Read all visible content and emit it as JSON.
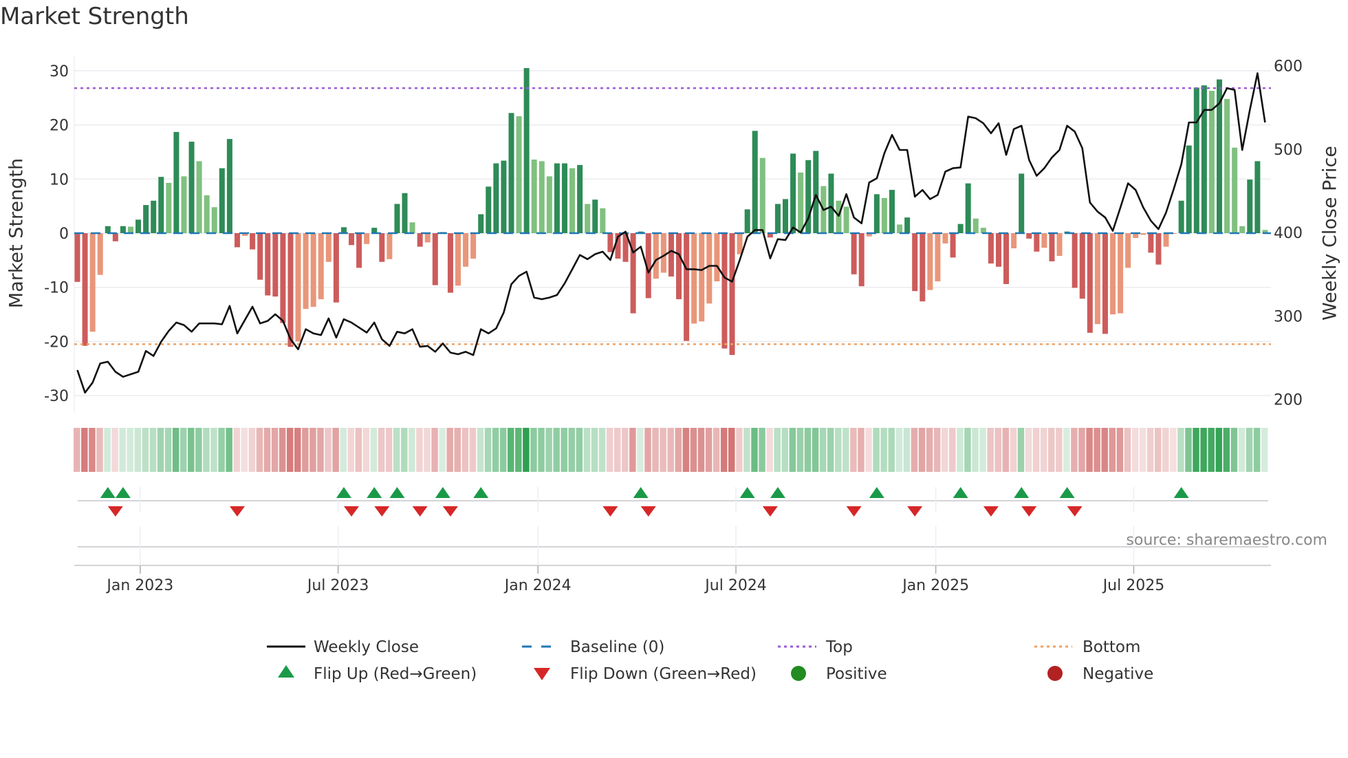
{
  "chart_data": {
    "type": "bar",
    "title": "Market Strength",
    "ylabel": "Market Strength",
    "y2label": "Weekly Close Price",
    "ylim": [
      -33,
      33
    ],
    "y2lim": [
      190,
      610
    ],
    "yticks": [
      30,
      20,
      10,
      0,
      -10,
      -20,
      -30
    ],
    "y2ticks": [
      600,
      500,
      400,
      300,
      200
    ],
    "xticks": [
      "Jan 2023",
      "Jul 2023",
      "Jan 2024",
      "Jul 2024",
      "Jan 2025",
      "Jul 2025"
    ],
    "xtick_week_index": [
      8.25,
      34.25,
      60.5,
      86.5,
      112.75,
      138.75
    ],
    "top_level": 26.8,
    "bottom_level": -20.5,
    "baseline": 0,
    "strength": [
      -9,
      -20.8,
      -18.2,
      -7.7,
      1.3,
      -1.5,
      1.3,
      1.2,
      2.5,
      5.2,
      6,
      10.4,
      9.3,
      18.7,
      10.5,
      16.9,
      13.3,
      7,
      4.8,
      12,
      17.4,
      -2.6,
      -0.5,
      -3,
      -8.6,
      -11.5,
      -11.7,
      -16.6,
      -21,
      -20,
      -14,
      -13.6,
      -12.2,
      -5.3,
      -12.8,
      1.1,
      -2.2,
      -6.4,
      -2,
      1,
      -5.3,
      -4.8,
      5.4,
      7.4,
      2,
      -2.5,
      -1.7,
      -9.6,
      0.2,
      -11,
      -9.7,
      -6.2,
      -4.7,
      3.5,
      8.6,
      12.9,
      13.4,
      22.2,
      21.6,
      30.5,
      13.6,
      13.3,
      10.5,
      12.9,
      12.9,
      12,
      12.6,
      5.4,
      6.2,
      4.6,
      -3.5,
      -4.7,
      -5.3,
      -14.8,
      0.3,
      -12,
      -8.4,
      -7.3,
      -8,
      -12.2,
      -19.9,
      -16.7,
      -16.3,
      -13,
      -8.9,
      -21.3,
      -22.5,
      -3.9,
      4.4,
      18.9,
      13.9,
      -0.8,
      5.4,
      6.3,
      14.7,
      11.2,
      13.5,
      15.2,
      8.7,
      11,
      6,
      4.9,
      -7.6,
      -9.8,
      -0.6,
      7.2,
      6.5,
      8,
      1.6,
      2.9,
      -10.7,
      -12.6,
      -10.5,
      -8.9,
      -1.9,
      -4.5,
      1.7,
      9.2,
      2.7,
      1,
      -5.6,
      -6.2,
      -9.4,
      -2.8,
      11,
      -1,
      -3.4,
      -2.7,
      -5.2,
      -4.2,
      0.3,
      -10.1,
      -12.1,
      -18.4,
      -16.8,
      -18.6,
      -15,
      -14.8,
      -6.4,
      -0.9,
      -0.3,
      -3.6,
      -5.8,
      -2.5,
      -0.1,
      6,
      16.2,
      26.9,
      27.3,
      26.3,
      28.4,
      24.8,
      15.8,
      1.3,
      9.9,
      13.3,
      0.6
    ],
    "weekly_close": [
      235,
      208,
      220,
      243,
      245,
      233,
      227,
      230,
      233,
      258,
      252,
      269,
      282,
      292,
      289,
      281,
      291,
      291,
      291,
      290,
      312,
      279,
      295,
      311,
      291,
      294,
      302,
      294,
      272,
      260,
      284,
      279,
      277,
      297,
      274,
      296,
      292,
      286,
      280,
      292,
      272,
      264,
      281,
      279,
      284,
      263,
      264,
      257,
      267,
      256,
      254,
      257,
      253,
      284,
      279,
      285,
      304,
      338,
      348,
      353,
      322,
      320,
      322,
      325,
      339,
      356,
      373,
      368,
      374,
      377,
      367,
      395,
      401,
      376,
      383,
      352,
      367,
      372,
      378,
      374,
      356,
      356,
      355,
      360,
      360,
      346,
      341,
      367,
      395,
      403,
      403,
      369,
      392,
      391,
      406,
      400,
      417,
      445,
      427,
      431,
      420,
      446,
      418,
      411,
      460,
      465,
      495,
      517,
      499,
      499,
      443,
      451,
      440,
      445,
      473,
      477,
      478,
      539,
      537,
      531,
      519,
      531,
      493,
      524,
      528,
      487,
      468,
      477,
      490,
      499,
      528,
      521,
      501,
      436,
      425,
      418,
      402,
      430,
      459,
      451,
      430,
      414,
      404,
      424,
      452,
      482,
      532,
      532,
      547,
      547,
      555,
      573,
      571,
      499,
      547,
      591,
      532
    ],
    "flip_up_index": [
      4,
      6,
      35,
      39,
      42,
      48,
      53,
      74,
      88,
      92,
      105,
      116,
      124,
      130,
      145
    ],
    "flip_down_index": [
      5,
      21,
      36,
      40,
      45,
      49,
      70,
      75,
      91,
      102,
      110,
      120,
      125,
      131
    ],
    "legend": {
      "weekly_close": "Weekly Close",
      "baseline": "Baseline (0)",
      "top": "Top",
      "bottom": "Bottom",
      "flip_up": "Flip Up (Red→Green)",
      "flip_down": "Flip Down (Green→Red)",
      "positive": "Positive",
      "negative": "Negative"
    },
    "legend_placement": "bottom",
    "source": "source: sharemaestro.com",
    "colors": {
      "green_dark": "#2e8b57",
      "green_light": "#80c080",
      "red_dark": "#cd5c5c",
      "red_light": "#e9967a",
      "line": "#111111",
      "baseline": "#1f77b4",
      "top": "#9b59d6",
      "bottom": "#f0a060",
      "flip_up": "#1a9a48",
      "flip_down": "#d62728",
      "positive": "#228b22",
      "negative": "#b22222"
    }
  }
}
